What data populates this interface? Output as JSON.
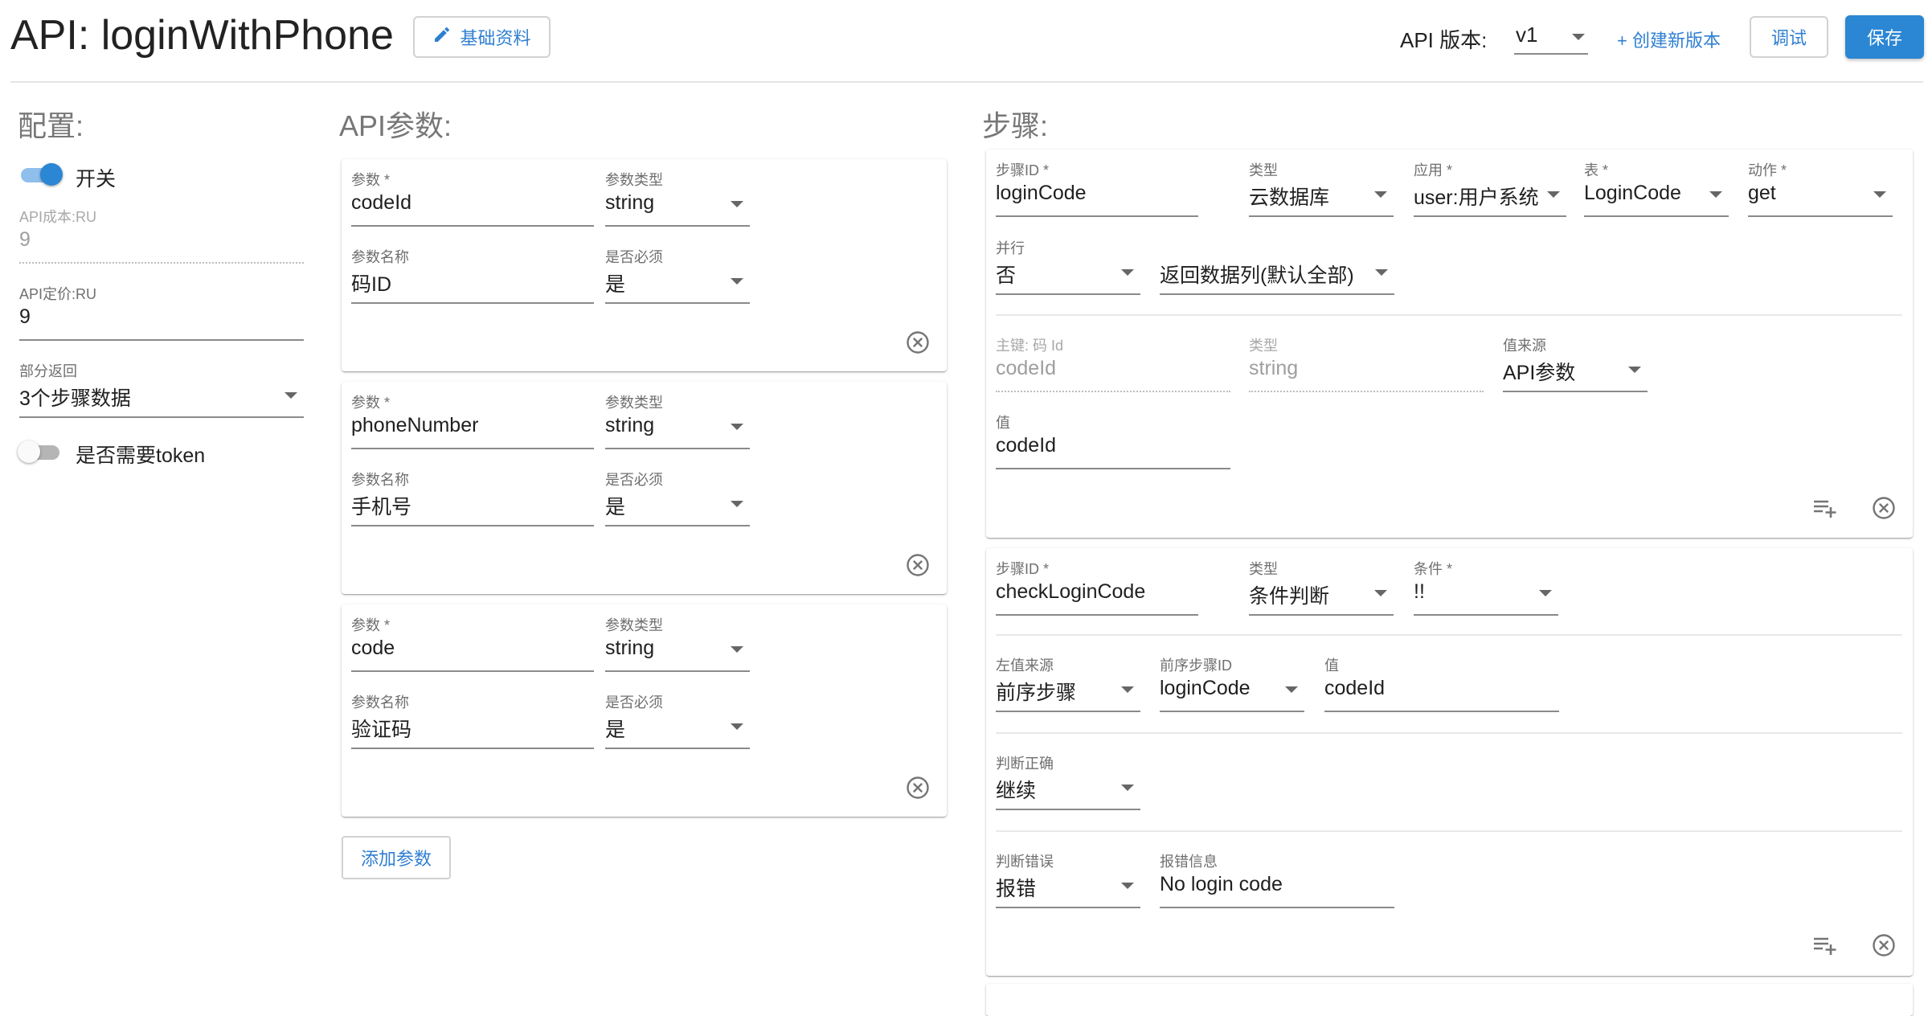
{
  "header": {
    "title": "API: loginWithPhone",
    "basic_info_label": "基础资料",
    "version_label": "API 版本:",
    "version_value": "v1",
    "create_version_label": "+ 创建新版本",
    "debug_label": "调试",
    "save_label": "保存"
  },
  "config": {
    "title": "配置:",
    "switch_label": "开关",
    "switch_on": true,
    "cost_label": "API成本:RU",
    "cost_value": "9",
    "price_label": "API定价:RU",
    "price_value": "9",
    "partial_label": "部分返回",
    "partial_value": "3个步骤数据",
    "token_label": "是否需要token",
    "token_on": false
  },
  "params": {
    "title": "API参数:",
    "param_label": "参数",
    "type_label": "参数类型",
    "name_label": "参数名称",
    "required_label": "是否必须",
    "items": [
      {
        "param": "codeId",
        "type": "string",
        "name": "码ID",
        "required": "是"
      },
      {
        "param": "phoneNumber",
        "type": "string",
        "name": "手机号",
        "required": "是"
      },
      {
        "param": "code",
        "type": "string",
        "name": "验证码",
        "required": "是"
      }
    ],
    "add_label": "添加参数"
  },
  "steps": {
    "title": "步骤:",
    "step1": {
      "id_label": "步骤ID",
      "id": "loginCode",
      "type_label": "类型",
      "type": "云数据库",
      "app_label": "应用",
      "app": "user:用户系统",
      "table_label": "表",
      "table": "LoginCode",
      "action_label": "动作",
      "action": "get",
      "parallel_label": "并行",
      "parallel": "否",
      "return_cols": "返回数据列(默认全部)",
      "pk_label": "主键: 码 Id",
      "pk": "codeId",
      "pk_type_label": "类型",
      "pk_type": "string",
      "source_label": "值来源",
      "source": "API参数",
      "value_label": "值",
      "value": "codeId"
    },
    "step2": {
      "id_label": "步骤ID",
      "id": "checkLoginCode",
      "type_label": "类型",
      "type": "条件判断",
      "cond_label": "条件",
      "cond": "!!",
      "left_source_label": "左值来源",
      "left_source": "前序步骤",
      "prev_step_label": "前序步骤ID",
      "prev_step": "loginCode",
      "value_label": "值",
      "value": "codeId",
      "on_true_label": "判断正确",
      "on_true": "继续",
      "on_false_label": "判断错误",
      "on_false": "报错",
      "error_label": "报错信息",
      "error": "No login code"
    }
  },
  "colors": {
    "primary": "#2b86d4",
    "link": "#2f7fd1",
    "section_title": "#777777"
  }
}
